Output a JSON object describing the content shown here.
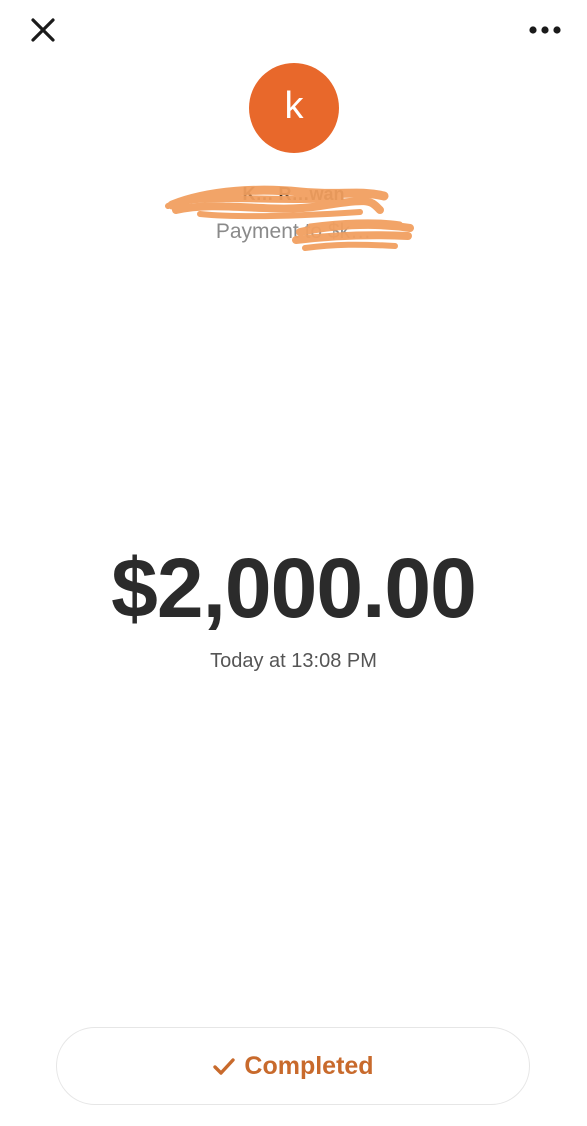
{
  "header": {
    "close_icon": "close-icon",
    "more_icon": "more-options-icon"
  },
  "recipient": {
    "avatar_letter": "k",
    "avatar_color": "#e8682b",
    "name": "K… R…wan",
    "payment_to": "Payment to $k…"
  },
  "payment": {
    "amount": "$2,000.00",
    "timestamp": "Today at 13:08 PM"
  },
  "status": {
    "label": "Completed",
    "icon": "check-icon",
    "color": "#c86a2c"
  },
  "redaction_color": "#f2a060"
}
